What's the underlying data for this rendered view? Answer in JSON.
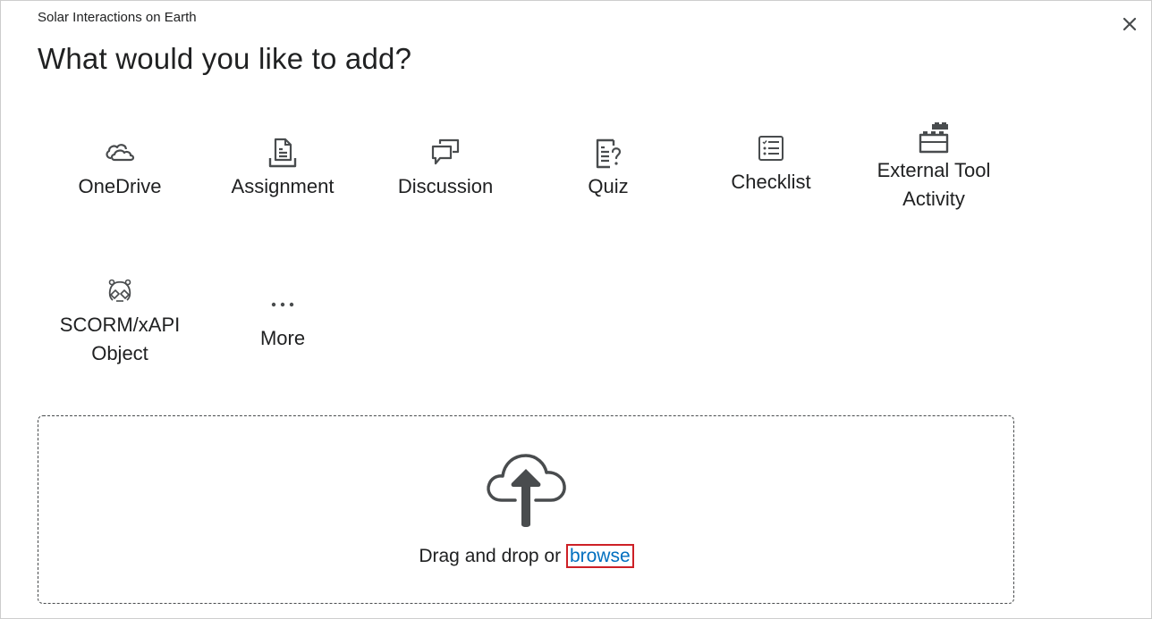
{
  "dialog": {
    "course_name": "Solar Interactions on Earth",
    "title": "What would you like to add?",
    "close_icon": "close-icon"
  },
  "tiles": [
    {
      "label": "OneDrive",
      "icon": "cloud-icon"
    },
    {
      "label": "Assignment",
      "icon": "assignment-icon"
    },
    {
      "label": "Discussion",
      "icon": "discussion-icon"
    },
    {
      "label": "Quiz",
      "icon": "quiz-icon"
    },
    {
      "label": "Checklist",
      "icon": "checklist-icon"
    },
    {
      "label": "External Tool Activity",
      "icon": "external-tool-icon"
    },
    {
      "label": "SCORM/xAPI Object",
      "icon": "scorm-icon"
    },
    {
      "label": "More",
      "icon": "more-icon"
    }
  ],
  "upload": {
    "icon": "upload-cloud-icon",
    "text": "Drag and drop or",
    "browse_label": "browse"
  },
  "colors": {
    "text": "#202122",
    "icon": "#494c4e",
    "link": "#006fbf",
    "focus_ring": "#cd2026"
  }
}
